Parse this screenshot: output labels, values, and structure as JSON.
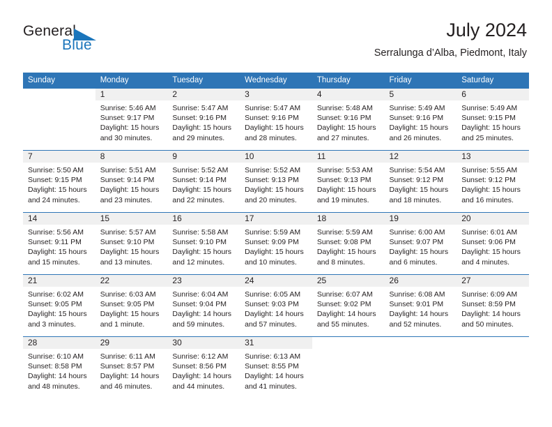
{
  "brand": {
    "name_part1": "General",
    "name_part2": "Blue",
    "accent_color": "#1b75bb",
    "triangle_icon": "triangle-icon"
  },
  "header": {
    "title": "July 2024",
    "subtitle": "Serralunga d’Alba, Piedmont, Italy"
  },
  "theme": {
    "header_row_bg": "#2e75b6",
    "daynum_band_bg": "#f0f0f0",
    "text_color": "#231f20",
    "page_bg": "#ffffff"
  },
  "weekday_headers": [
    "Sunday",
    "Monday",
    "Tuesday",
    "Wednesday",
    "Thursday",
    "Friday",
    "Saturday"
  ],
  "weeks": [
    [
      {
        "day": "",
        "sunrise": "",
        "sunset": "",
        "daylight_l1": "",
        "daylight_l2": "",
        "blank": true
      },
      {
        "day": "1",
        "sunrise": "Sunrise: 5:46 AM",
        "sunset": "Sunset: 9:17 PM",
        "daylight_l1": "Daylight: 15 hours",
        "daylight_l2": "and 30 minutes."
      },
      {
        "day": "2",
        "sunrise": "Sunrise: 5:47 AM",
        "sunset": "Sunset: 9:16 PM",
        "daylight_l1": "Daylight: 15 hours",
        "daylight_l2": "and 29 minutes."
      },
      {
        "day": "3",
        "sunrise": "Sunrise: 5:47 AM",
        "sunset": "Sunset: 9:16 PM",
        "daylight_l1": "Daylight: 15 hours",
        "daylight_l2": "and 28 minutes."
      },
      {
        "day": "4",
        "sunrise": "Sunrise: 5:48 AM",
        "sunset": "Sunset: 9:16 PM",
        "daylight_l1": "Daylight: 15 hours",
        "daylight_l2": "and 27 minutes."
      },
      {
        "day": "5",
        "sunrise": "Sunrise: 5:49 AM",
        "sunset": "Sunset: 9:16 PM",
        "daylight_l1": "Daylight: 15 hours",
        "daylight_l2": "and 26 minutes."
      },
      {
        "day": "6",
        "sunrise": "Sunrise: 5:49 AM",
        "sunset": "Sunset: 9:15 PM",
        "daylight_l1": "Daylight: 15 hours",
        "daylight_l2": "and 25 minutes."
      }
    ],
    [
      {
        "day": "7",
        "sunrise": "Sunrise: 5:50 AM",
        "sunset": "Sunset: 9:15 PM",
        "daylight_l1": "Daylight: 15 hours",
        "daylight_l2": "and 24 minutes."
      },
      {
        "day": "8",
        "sunrise": "Sunrise: 5:51 AM",
        "sunset": "Sunset: 9:14 PM",
        "daylight_l1": "Daylight: 15 hours",
        "daylight_l2": "and 23 minutes."
      },
      {
        "day": "9",
        "sunrise": "Sunrise: 5:52 AM",
        "sunset": "Sunset: 9:14 PM",
        "daylight_l1": "Daylight: 15 hours",
        "daylight_l2": "and 22 minutes."
      },
      {
        "day": "10",
        "sunrise": "Sunrise: 5:52 AM",
        "sunset": "Sunset: 9:13 PM",
        "daylight_l1": "Daylight: 15 hours",
        "daylight_l2": "and 20 minutes."
      },
      {
        "day": "11",
        "sunrise": "Sunrise: 5:53 AM",
        "sunset": "Sunset: 9:13 PM",
        "daylight_l1": "Daylight: 15 hours",
        "daylight_l2": "and 19 minutes."
      },
      {
        "day": "12",
        "sunrise": "Sunrise: 5:54 AM",
        "sunset": "Sunset: 9:12 PM",
        "daylight_l1": "Daylight: 15 hours",
        "daylight_l2": "and 18 minutes."
      },
      {
        "day": "13",
        "sunrise": "Sunrise: 5:55 AM",
        "sunset": "Sunset: 9:12 PM",
        "daylight_l1": "Daylight: 15 hours",
        "daylight_l2": "and 16 minutes."
      }
    ],
    [
      {
        "day": "14",
        "sunrise": "Sunrise: 5:56 AM",
        "sunset": "Sunset: 9:11 PM",
        "daylight_l1": "Daylight: 15 hours",
        "daylight_l2": "and 15 minutes."
      },
      {
        "day": "15",
        "sunrise": "Sunrise: 5:57 AM",
        "sunset": "Sunset: 9:10 PM",
        "daylight_l1": "Daylight: 15 hours",
        "daylight_l2": "and 13 minutes."
      },
      {
        "day": "16",
        "sunrise": "Sunrise: 5:58 AM",
        "sunset": "Sunset: 9:10 PM",
        "daylight_l1": "Daylight: 15 hours",
        "daylight_l2": "and 12 minutes."
      },
      {
        "day": "17",
        "sunrise": "Sunrise: 5:59 AM",
        "sunset": "Sunset: 9:09 PM",
        "daylight_l1": "Daylight: 15 hours",
        "daylight_l2": "and 10 minutes."
      },
      {
        "day": "18",
        "sunrise": "Sunrise: 5:59 AM",
        "sunset": "Sunset: 9:08 PM",
        "daylight_l1": "Daylight: 15 hours",
        "daylight_l2": "and 8 minutes."
      },
      {
        "day": "19",
        "sunrise": "Sunrise: 6:00 AM",
        "sunset": "Sunset: 9:07 PM",
        "daylight_l1": "Daylight: 15 hours",
        "daylight_l2": "and 6 minutes."
      },
      {
        "day": "20",
        "sunrise": "Sunrise: 6:01 AM",
        "sunset": "Sunset: 9:06 PM",
        "daylight_l1": "Daylight: 15 hours",
        "daylight_l2": "and 4 minutes."
      }
    ],
    [
      {
        "day": "21",
        "sunrise": "Sunrise: 6:02 AM",
        "sunset": "Sunset: 9:05 PM",
        "daylight_l1": "Daylight: 15 hours",
        "daylight_l2": "and 3 minutes."
      },
      {
        "day": "22",
        "sunrise": "Sunrise: 6:03 AM",
        "sunset": "Sunset: 9:05 PM",
        "daylight_l1": "Daylight: 15 hours",
        "daylight_l2": "and 1 minute."
      },
      {
        "day": "23",
        "sunrise": "Sunrise: 6:04 AM",
        "sunset": "Sunset: 9:04 PM",
        "daylight_l1": "Daylight: 14 hours",
        "daylight_l2": "and 59 minutes."
      },
      {
        "day": "24",
        "sunrise": "Sunrise: 6:05 AM",
        "sunset": "Sunset: 9:03 PM",
        "daylight_l1": "Daylight: 14 hours",
        "daylight_l2": "and 57 minutes."
      },
      {
        "day": "25",
        "sunrise": "Sunrise: 6:07 AM",
        "sunset": "Sunset: 9:02 PM",
        "daylight_l1": "Daylight: 14 hours",
        "daylight_l2": "and 55 minutes."
      },
      {
        "day": "26",
        "sunrise": "Sunrise: 6:08 AM",
        "sunset": "Sunset: 9:01 PM",
        "daylight_l1": "Daylight: 14 hours",
        "daylight_l2": "and 52 minutes."
      },
      {
        "day": "27",
        "sunrise": "Sunrise: 6:09 AM",
        "sunset": "Sunset: 8:59 PM",
        "daylight_l1": "Daylight: 14 hours",
        "daylight_l2": "and 50 minutes."
      }
    ],
    [
      {
        "day": "28",
        "sunrise": "Sunrise: 6:10 AM",
        "sunset": "Sunset: 8:58 PM",
        "daylight_l1": "Daylight: 14 hours",
        "daylight_l2": "and 48 minutes."
      },
      {
        "day": "29",
        "sunrise": "Sunrise: 6:11 AM",
        "sunset": "Sunset: 8:57 PM",
        "daylight_l1": "Daylight: 14 hours",
        "daylight_l2": "and 46 minutes."
      },
      {
        "day": "30",
        "sunrise": "Sunrise: 6:12 AM",
        "sunset": "Sunset: 8:56 PM",
        "daylight_l1": "Daylight: 14 hours",
        "daylight_l2": "and 44 minutes."
      },
      {
        "day": "31",
        "sunrise": "Sunrise: 6:13 AM",
        "sunset": "Sunset: 8:55 PM",
        "daylight_l1": "Daylight: 14 hours",
        "daylight_l2": "and 41 minutes."
      },
      {
        "day": "",
        "sunrise": "",
        "sunset": "",
        "daylight_l1": "",
        "daylight_l2": "",
        "blank": true
      },
      {
        "day": "",
        "sunrise": "",
        "sunset": "",
        "daylight_l1": "",
        "daylight_l2": "",
        "blank": true
      },
      {
        "day": "",
        "sunrise": "",
        "sunset": "",
        "daylight_l1": "",
        "daylight_l2": "",
        "blank": true
      }
    ]
  ]
}
